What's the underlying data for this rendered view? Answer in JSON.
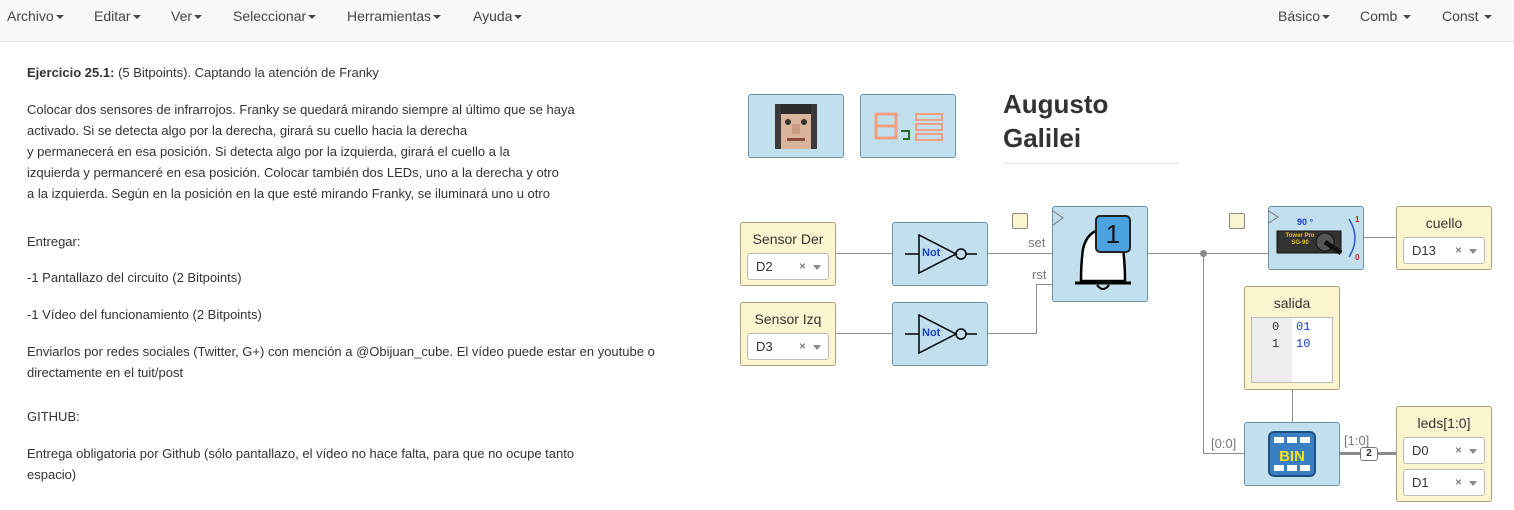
{
  "menu": {
    "left": [
      "Archivo",
      "Editar",
      "Ver",
      "Seleccionar",
      "Herramientas",
      "Ayuda"
    ],
    "right": [
      "Básico",
      "Comb",
      "Const"
    ]
  },
  "description": {
    "title": "Ejercicio 25.1:",
    "title_rest": " (5 Bitpoints). Captando la atención de Franky",
    "paragraph": [
      "Colocar dos sensores de infrarrojos. Franky se quedará mirando siempre al último que se haya",
      "activado. Si se detecta algo por la derecha, girará su cuello hacia la derecha",
      "y permanecerá en esa posición. Si detecta algo por la izquierda, girará el cuello a la",
      "izquierda y permanceré en esa posición. Colocar también dos LEDs, uno a la derecha y otro",
      "a la izquierda. Según en la posición en la que esté mirando Franky, se iluminará uno u otro"
    ],
    "deliver_heading": "Entregar:",
    "deliver_1": "-1 Pantallazo del circuito (2 Bitpoints)",
    "deliver_2": "-1 Vídeo del funcionamiento (2 Bitpoints)",
    "send": [
      "Enviarlos por redes sociales (Twitter, G+) con mención a @Obijuan_cube. El vídeo puede estar en youtube o",
      "directamente en el tuit/post"
    ],
    "github_heading": "GITHUB:",
    "github": [
      "Entrega obligatoria por Github (sólo pantallazo, el vídeo no hace falta, para que no ocupe tanto",
      "espacio)"
    ]
  },
  "author": {
    "line1": "Augusto",
    "line2": "Galilei"
  },
  "circuit": {
    "sensor_der": {
      "label": "Sensor Der",
      "value": "D2"
    },
    "sensor_izq": {
      "label": "Sensor Izq",
      "value": "D3"
    },
    "not_label": "Not",
    "flipflop": {
      "value": "1",
      "set": "set",
      "rst": "rst"
    },
    "servo": {
      "angle": "90 °",
      "brand": "Tower Pro SG-90",
      "scale_hi": "1",
      "scale_lo": "0"
    },
    "cuello": {
      "label": "cuello",
      "value": "D13"
    },
    "salida": {
      "label": "salida",
      "rows": [
        {
          "addr": "0",
          "val": "01"
        },
        {
          "addr": "1",
          "val": "10"
        }
      ]
    },
    "bin": {
      "label": "BIN",
      "in_label": "[0:0]",
      "out_label": "[1:0]",
      "bus": "2"
    },
    "leds": {
      "label": "leds[1:0]",
      "values": [
        "D0",
        "D1"
      ]
    },
    "clear_symbol": "×"
  },
  "colors": {
    "block_blue": "#c2dfed",
    "block_yellow": "#fbf6d0",
    "flipflop_badge": "#4aa3df",
    "not_text": "#1a3fd0"
  }
}
